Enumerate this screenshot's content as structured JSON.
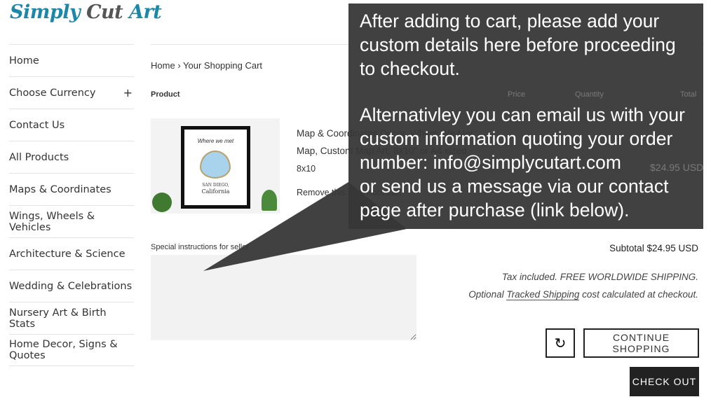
{
  "logo": {
    "part1": "Simply",
    "part2": "Cut",
    "part3": "Art"
  },
  "sidebar": {
    "items": [
      {
        "label": "Home"
      },
      {
        "label": "Choose Currency",
        "expand": "+"
      },
      {
        "label": "Contact Us"
      },
      {
        "label": "All Products"
      },
      {
        "label": "Maps & Coordinates"
      },
      {
        "label": "Wings, Wheels & Vehicles"
      },
      {
        "label": "Architecture & Science"
      },
      {
        "label": "Wedding & Celebrations"
      },
      {
        "label": "Nursery Art & Birth Stats"
      },
      {
        "label": "Home Decor, Signs & Quotes"
      }
    ]
  },
  "breadcrumb": {
    "home": "Home",
    "sep": "›",
    "current": "Your Shopping Cart"
  },
  "table": {
    "headers": {
      "product": "Product",
      "price": "Price",
      "quantity": "Quantity",
      "total": "Total"
    }
  },
  "item": {
    "title_line1": "Map & Coordinates Decor, Where We Met",
    "title_line2": "Map, Custom Map Art, 8x10\" or A4 sized",
    "variant": "8x10",
    "remove": "Remove this item from cart",
    "total": "$24.95 USD",
    "image_text": {
      "heading": "Where we met",
      "city": "SAN DIEGO,",
      "state": "California"
    }
  },
  "overlay": {
    "para1": "After adding to cart, please add your\ncustom details here before proceeding\nto checkout.",
    "para2": "Alternativley you can email us with your\ncustom information quoting your order\nnumber:  info@simplycutart.com\nor send us a message via our contact\npage after purchase (link below)."
  },
  "notes": {
    "label": "Special instructions for seller",
    "value": ""
  },
  "summary": {
    "subtotal": "Subtotal $24.95 USD",
    "tax": "Tax included. FREE WORLDWIDE SHIPPING.",
    "ship_pre": "Optional ",
    "ship_link": "Tracked Shipping",
    "ship_post": " cost calculated at checkout."
  },
  "buttons": {
    "refresh_icon": "↻",
    "continue": "CONTINUE SHOPPING",
    "checkout": "CHECK OUT"
  }
}
